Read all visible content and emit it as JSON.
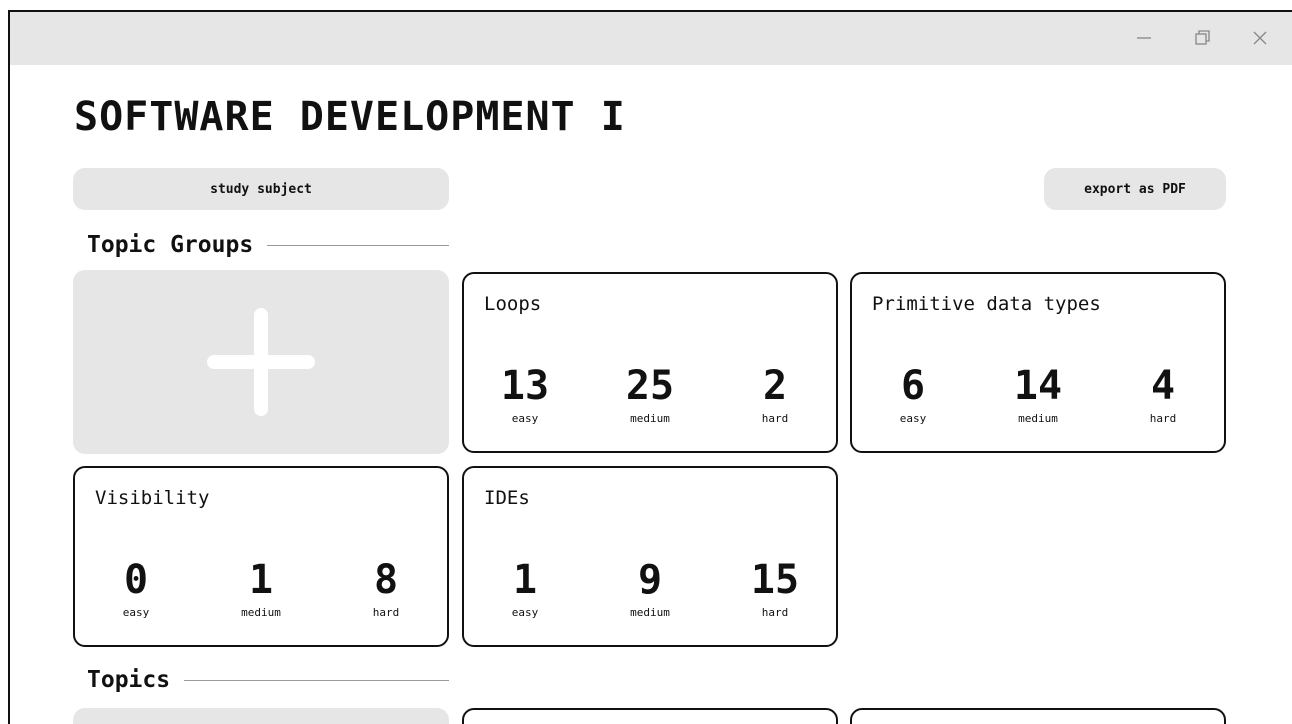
{
  "window": {
    "controls": [
      "minimize-icon",
      "maximize-icon",
      "close-icon"
    ]
  },
  "page": {
    "title": "SOFTWARE DEVELOPMENT I"
  },
  "actions": {
    "study_label": "study subject",
    "export_label": "export as PDF"
  },
  "sections": {
    "topic_groups": "Topic Groups",
    "topics": "Topics"
  },
  "add_icon": "plus-icon",
  "topic_groups": [
    {
      "name": "Loops",
      "easy": "13",
      "medium": "25",
      "hard": "2"
    },
    {
      "name": "Primitive data types",
      "easy": "6",
      "medium": "14",
      "hard": "4"
    },
    {
      "name": "Visibility",
      "easy": "0",
      "medium": "1",
      "hard": "8"
    },
    {
      "name": "IDEs",
      "easy": "1",
      "medium": "9",
      "hard": "15"
    }
  ],
  "labels": {
    "easy": "easy",
    "medium": "medium",
    "hard": "hard"
  },
  "colors": {
    "panel": "#e6e6e6",
    "border": "#111111",
    "background": "#ffffff"
  }
}
